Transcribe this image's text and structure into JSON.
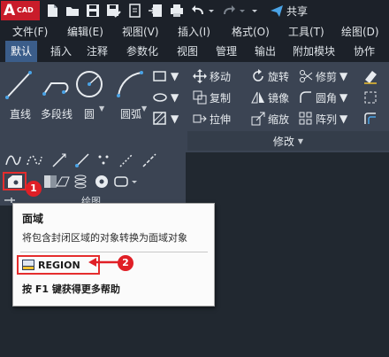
{
  "app": {
    "logo_letter": "A",
    "logo_text": "CAD"
  },
  "quick_access": {
    "share_label": "共享"
  },
  "menu": [
    "文件(F)",
    "编辑(E)",
    "视图(V)",
    "插入(I)",
    "格式(O)",
    "工具(T)",
    "绘图(D)"
  ],
  "tabs": [
    "默认",
    "插入",
    "注释",
    "参数化",
    "视图",
    "管理",
    "输出",
    "附加模块",
    "协作"
  ],
  "active_tab": "默认",
  "draw_panel": {
    "title": "绘图",
    "line": "直线",
    "polyline": "多段线",
    "circle": "圆",
    "arc": "圆弧"
  },
  "modify_panel": {
    "title": "修改",
    "move": "移动",
    "rotate": "旋转",
    "trim": "修剪",
    "copy": "复制",
    "mirror": "镜像",
    "fillet": "圆角",
    "stretch": "拉伸",
    "scale": "缩放",
    "array": "阵列"
  },
  "tooltip": {
    "title": "面域",
    "description": "将包含封闭区域的对象转换为面域对象",
    "command": "REGION",
    "help": "按 F1 键获得更多帮助"
  },
  "callouts": {
    "first": "1",
    "second": "2"
  },
  "colors": {
    "accent_blue": "#3b5d8a",
    "callout_red": "#e01f26",
    "ribbon_bg": "#3b4453"
  }
}
